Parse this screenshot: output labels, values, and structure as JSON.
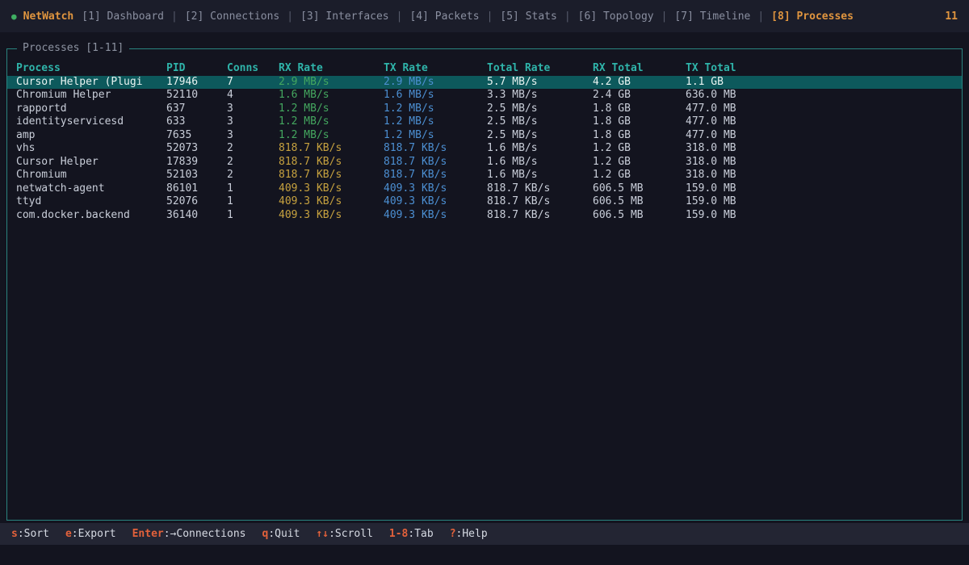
{
  "app": {
    "title": "NetWatch",
    "status_dot": "●",
    "header_count": "11"
  },
  "tabs": {
    "separator": "|",
    "items": [
      {
        "label": "[1] Dashboard",
        "active": false
      },
      {
        "label": "[2] Connections",
        "active": false
      },
      {
        "label": "[3] Interfaces",
        "active": false
      },
      {
        "label": "[4] Packets",
        "active": false
      },
      {
        "label": "[5] Stats",
        "active": false
      },
      {
        "label": "[6] Topology",
        "active": false
      },
      {
        "label": "[7] Timeline",
        "active": false
      },
      {
        "label": "[8] Processes",
        "active": true
      }
    ]
  },
  "panel": {
    "title": "Processes [1-11]"
  },
  "table": {
    "headers": [
      "Process",
      "PID",
      "Conns",
      "RX Rate",
      "TX Rate",
      "Total Rate",
      "RX Total",
      "TX Total"
    ],
    "rows": [
      {
        "process": "Cursor Helper (Plugi",
        "pid": "17946",
        "conns": "7",
        "rx": "2.9 MB/s",
        "tx": "2.9 MB/s",
        "total": "5.7 MB/s",
        "rx_total": "4.2 GB",
        "tx_total": "1.1 GB",
        "rx_color": "green",
        "tx_color": "blue",
        "selected": true
      },
      {
        "process": "Chromium Helper",
        "pid": "52110",
        "conns": "4",
        "rx": "1.6 MB/s",
        "tx": "1.6 MB/s",
        "total": "3.3 MB/s",
        "rx_total": "2.4 GB",
        "tx_total": "636.0 MB",
        "rx_color": "green",
        "tx_color": "blue",
        "selected": false
      },
      {
        "process": "rapportd",
        "pid": "637",
        "conns": "3",
        "rx": "1.2 MB/s",
        "tx": "1.2 MB/s",
        "total": "2.5 MB/s",
        "rx_total": "1.8 GB",
        "tx_total": "477.0 MB",
        "rx_color": "green",
        "tx_color": "blue",
        "selected": false
      },
      {
        "process": "identityservicesd",
        "pid": "633",
        "conns": "3",
        "rx": "1.2 MB/s",
        "tx": "1.2 MB/s",
        "total": "2.5 MB/s",
        "rx_total": "1.8 GB",
        "tx_total": "477.0 MB",
        "rx_color": "green",
        "tx_color": "blue",
        "selected": false
      },
      {
        "process": "amp",
        "pid": "7635",
        "conns": "3",
        "rx": "1.2 MB/s",
        "tx": "1.2 MB/s",
        "total": "2.5 MB/s",
        "rx_total": "1.8 GB",
        "tx_total": "477.0 MB",
        "rx_color": "green",
        "tx_color": "blue",
        "selected": false
      },
      {
        "process": "vhs",
        "pid": "52073",
        "conns": "2",
        "rx": "818.7 KB/s",
        "tx": "818.7 KB/s",
        "total": "1.6 MB/s",
        "rx_total": "1.2 GB",
        "tx_total": "318.0 MB",
        "rx_color": "yellow",
        "tx_color": "blue",
        "selected": false
      },
      {
        "process": "Cursor Helper",
        "pid": "17839",
        "conns": "2",
        "rx": "818.7 KB/s",
        "tx": "818.7 KB/s",
        "total": "1.6 MB/s",
        "rx_total": "1.2 GB",
        "tx_total": "318.0 MB",
        "rx_color": "yellow",
        "tx_color": "blue",
        "selected": false
      },
      {
        "process": "Chromium",
        "pid": "52103",
        "conns": "2",
        "rx": "818.7 KB/s",
        "tx": "818.7 KB/s",
        "total": "1.6 MB/s",
        "rx_total": "1.2 GB",
        "tx_total": "318.0 MB",
        "rx_color": "yellow",
        "tx_color": "blue",
        "selected": false
      },
      {
        "process": "netwatch-agent",
        "pid": "86101",
        "conns": "1",
        "rx": "409.3 KB/s",
        "tx": "409.3 KB/s",
        "total": "818.7 KB/s",
        "rx_total": "606.5 MB",
        "tx_total": "159.0 MB",
        "rx_color": "yellow",
        "tx_color": "blue",
        "selected": false
      },
      {
        "process": "ttyd",
        "pid": "52076",
        "conns": "1",
        "rx": "409.3 KB/s",
        "tx": "409.3 KB/s",
        "total": "818.7 KB/s",
        "rx_total": "606.5 MB",
        "tx_total": "159.0 MB",
        "rx_color": "yellow",
        "tx_color": "blue",
        "selected": false
      },
      {
        "process": "com.docker.backend",
        "pid": "36140",
        "conns": "1",
        "rx": "409.3 KB/s",
        "tx": "409.3 KB/s",
        "total": "818.7 KB/s",
        "rx_total": "606.5 MB",
        "tx_total": "159.0 MB",
        "rx_color": "yellow",
        "tx_color": "blue",
        "selected": false
      }
    ]
  },
  "statusbar": {
    "items": [
      {
        "key": "s",
        "desc": "Sort"
      },
      {
        "key": "e",
        "desc": "Export"
      },
      {
        "key": "Enter",
        "desc": "→Connections"
      },
      {
        "key": "q",
        "desc": "Quit"
      },
      {
        "key": "↑↓",
        "desc": "Scroll"
      },
      {
        "key": "1-8",
        "desc": "Tab"
      },
      {
        "key": "?",
        "desc": "Help"
      }
    ]
  },
  "colors": {
    "background": "#13141f",
    "topbar_bg": "#1b1d2a",
    "statusbar_bg": "#232533",
    "accent_orange": "#e0953f",
    "key_red": "#e2613b",
    "header_teal": "#2fb4aa",
    "border_teal": "#2a8480",
    "rate_green": "#44a75f",
    "rate_yellow": "#c7a23f",
    "rate_blue": "#4c8fd2",
    "selected_row_bg": "#0d595c",
    "status_dot_green": "#3fae62"
  }
}
